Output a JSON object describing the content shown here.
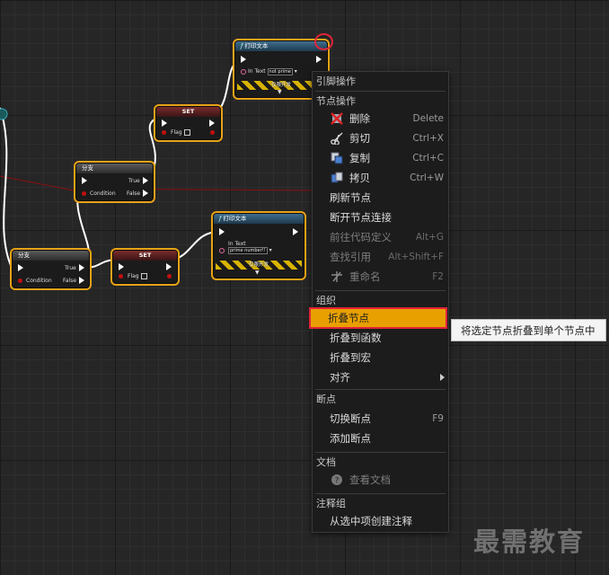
{
  "nodes": {
    "branch_a": {
      "title": "分支",
      "condition": "Condition",
      "true": "True",
      "false": "False"
    },
    "branch_b": {
      "title": "分支",
      "condition": "Condition",
      "true": "True",
      "false": "False"
    },
    "set_a": {
      "title": "SET",
      "flag": "Flag"
    },
    "set_b": {
      "title": "SET",
      "flag": "Flag"
    },
    "print_a": {
      "title": "打印文本",
      "in_text": "In Text",
      "value": "not prime",
      "dev_only": "仅限开发"
    },
    "print_b": {
      "title": "打印文本",
      "in_text": "In Text",
      "value": "prime number!!",
      "dev_only": "仅限开发"
    }
  },
  "menu": {
    "pin_actions": "引脚操作",
    "node_actions": "节点操作",
    "items_node": [
      {
        "label": "删除",
        "shortcut": "Delete",
        "icon": "delete-icon"
      },
      {
        "label": "剪切",
        "shortcut": "Ctrl+X",
        "icon": "scissors-icon"
      },
      {
        "label": "复制",
        "shortcut": "Ctrl+C",
        "icon": "copy-icon"
      },
      {
        "label": "拷贝",
        "shortcut": "Ctrl+W",
        "icon": "duplicate-icon"
      },
      {
        "label": "刷新节点",
        "shortcut": ""
      },
      {
        "label": "断开节点连接",
        "shortcut": ""
      },
      {
        "label": "前往代码定义",
        "shortcut": "Alt+G"
      },
      {
        "label": "查找引用",
        "shortcut": "Alt+Shift+F"
      },
      {
        "label": "重命名",
        "shortcut": "F2",
        "icon": "rename-icon"
      }
    ],
    "organize": "组织",
    "items_organize": [
      {
        "label": "折叠节点"
      },
      {
        "label": "折叠到函数"
      },
      {
        "label": "折叠到宏"
      },
      {
        "label": "对齐"
      }
    ],
    "breakpoint": "断点",
    "items_breakpoint": [
      {
        "label": "切换断点",
        "shortcut": "F9"
      },
      {
        "label": "添加断点"
      }
    ],
    "docs": "文档",
    "view_docs": "查看文档",
    "comment_group": "注释组",
    "create_comment": "从选中项创建注释"
  },
  "tooltip": "将选定节点折叠到单个节点中",
  "watermark": "最需教育",
  "colors": {
    "highlight": "#e8a000",
    "selection_outline": "#e8a317",
    "annotation": "#e0243a"
  }
}
